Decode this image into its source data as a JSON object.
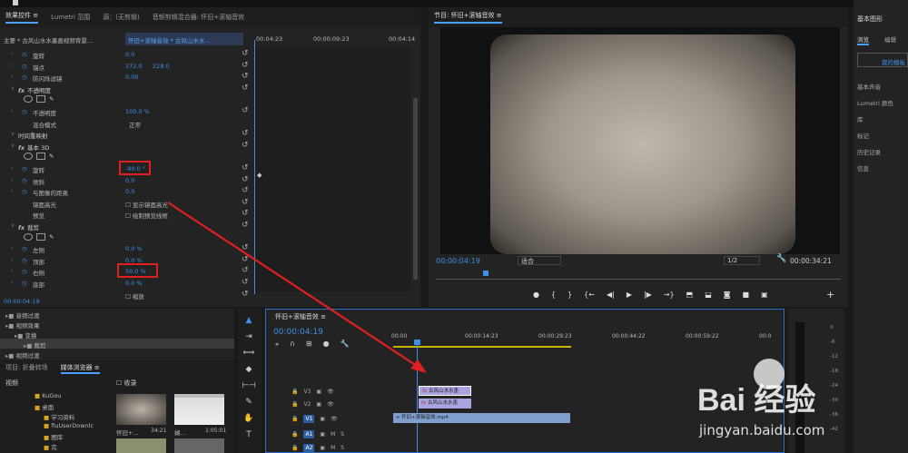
{
  "effect_controls": {
    "tabs": [
      "效果控件 ≡",
      "Lumetri 范围",
      "源：(无剪辑)",
      "音频剪辑混合器: 怀旧+滚轴音效"
    ],
    "source_clip": "主要 * 古风山水水墨画视频背景...",
    "sequence_clip": "怀旧+滚轴音效 * 古风山水水...",
    "mini_time_1": "00:04:23",
    "mini_time_2": "00:00:09:23",
    "mini_time_3": "00:04:14",
    "rows": [
      {
        "type": "prop",
        "label": "旋转",
        "value": "0.0"
      },
      {
        "type": "prop",
        "label": "锚点",
        "value": "372.0",
        "value2": "228.0"
      },
      {
        "type": "prop",
        "label": "防闪烁滤镜",
        "value": "0.00"
      },
      {
        "type": "section",
        "label": "不透明度"
      },
      {
        "type": "shapes"
      },
      {
        "type": "prop",
        "label": "不透明度",
        "value": "100.0 %"
      },
      {
        "type": "plain",
        "label": "混合模式",
        "value": "正常"
      },
      {
        "type": "section",
        "label": "时间重映射",
        "nofx": true
      },
      {
        "type": "section",
        "label": "基本 3D"
      },
      {
        "type": "shapes"
      },
      {
        "type": "prop",
        "label": "旋转",
        "value": "-90.0 °"
      },
      {
        "type": "prop",
        "label": "倾斜",
        "value": "0.0"
      },
      {
        "type": "prop",
        "label": "与图像的距离",
        "value": "0.0"
      },
      {
        "type": "check",
        "label": "镜面高光",
        "value": "显示镜面高光"
      },
      {
        "type": "check",
        "label": "预览",
        "value": "绘制预览线框"
      },
      {
        "type": "section",
        "label": "裁剪"
      },
      {
        "type": "shapes"
      },
      {
        "type": "prop",
        "label": "左侧",
        "value": "0.0 %"
      },
      {
        "type": "prop",
        "label": "顶部",
        "value": "0.0 %"
      },
      {
        "type": "prop",
        "label": "右侧",
        "value": "50.0 %"
      },
      {
        "type": "prop",
        "label": "底部",
        "value": "0.0 %"
      },
      {
        "type": "check",
        "label": "",
        "value": "缩放"
      }
    ],
    "current_time": "00:00:04:19"
  },
  "program_monitor": {
    "title": "节目: 怀旧+滚轴音效 ≡",
    "timecode": "00:00:04:19",
    "fit": "适合",
    "quality": "1/2",
    "duration": "00:00:34:21"
  },
  "effects_browser": {
    "items": [
      {
        "label": "音频过渡",
        "indent": 0
      },
      {
        "label": "视频效果",
        "indent": 0
      },
      {
        "label": "变换",
        "indent": 1
      },
      {
        "label": "裁剪",
        "indent": 2,
        "selected": true
      },
      {
        "label": "视频过渡",
        "indent": 0
      }
    ]
  },
  "project_panel": {
    "tabs": [
      "项目: 折叠转场",
      "媒体浏览器 ≡"
    ],
    "filter_label": "视频",
    "ingest_label": "收录",
    "folders": [
      "KuGou",
      "桌面",
      "学习资料",
      "fluUserDownlc",
      "图库",
      "完"
    ],
    "thumbs": [
      {
        "name": "怀旧+...",
        "duration": "34:21"
      },
      {
        "name": "蝴...",
        "duration": "1:05:01"
      }
    ]
  },
  "timeline": {
    "title": "怀旧+滚轴音效 ≡",
    "timecode": "00:00:04:19",
    "ruler": [
      "00:00",
      "00:00:14:23",
      "00:00:29:23",
      "00:00:44:22",
      "00:00:59:22",
      "00:0"
    ],
    "tracks": [
      {
        "label": "V3"
      },
      {
        "label": "V2"
      },
      {
        "label": "V1"
      },
      {
        "label": "A1"
      },
      {
        "label": "A2"
      }
    ],
    "clips": [
      {
        "track": "V3",
        "label": "古风山水水墨"
      },
      {
        "track": "V2",
        "label": "古风山水水墨"
      },
      {
        "track": "V1",
        "label": "怀旧+滚轴音效.mp4"
      }
    ]
  },
  "meters": {
    "labels": [
      "0",
      "-6",
      "-12",
      "-18",
      "-24",
      "-30",
      "-36",
      "-42"
    ]
  },
  "right_panel": {
    "title": "基本图形",
    "tabs": [
      "浏览",
      "编辑"
    ],
    "button": "我的模板",
    "items": [
      "基本声音",
      "Lumetri 颜色",
      "库",
      "标记",
      "历史记录",
      "信息"
    ]
  },
  "watermark": {
    "brand": "Bai 经验",
    "url": "jingyan.baidu.com"
  }
}
